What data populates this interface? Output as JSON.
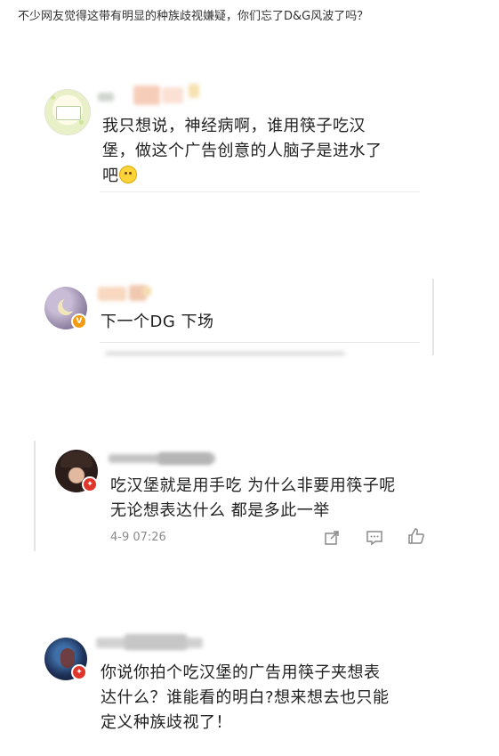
{
  "caption": "不少网友觉得这带有明显的种族歧视嫌疑，你们忘了D&G风波了吗？",
  "comments": [
    {
      "text_lines": [
        "我只想说，神经病啊，谁用筷子吃汉",
        "堡，做这个广告创意的人脑子是进水了",
        "吧"
      ],
      "emoji": "smile-emoji"
    },
    {
      "text_lines": [
        "下一个DG 下场"
      ]
    },
    {
      "text_lines": [
        "吃汉堡就是用手吃   为什么非要用筷子呢",
        "无论想表达什么 都是多此一举"
      ],
      "time": "4-9 07:26"
    },
    {
      "text_lines": [
        "你说你拍个吃汉堡的广告用筷子夹想表",
        "达什么？谁能看的明白?想来想去也只能",
        "定义种族歧视了！"
      ]
    }
  ],
  "colors": {
    "verified_badge": "#f39c12",
    "red_badge": "#e0352b"
  }
}
